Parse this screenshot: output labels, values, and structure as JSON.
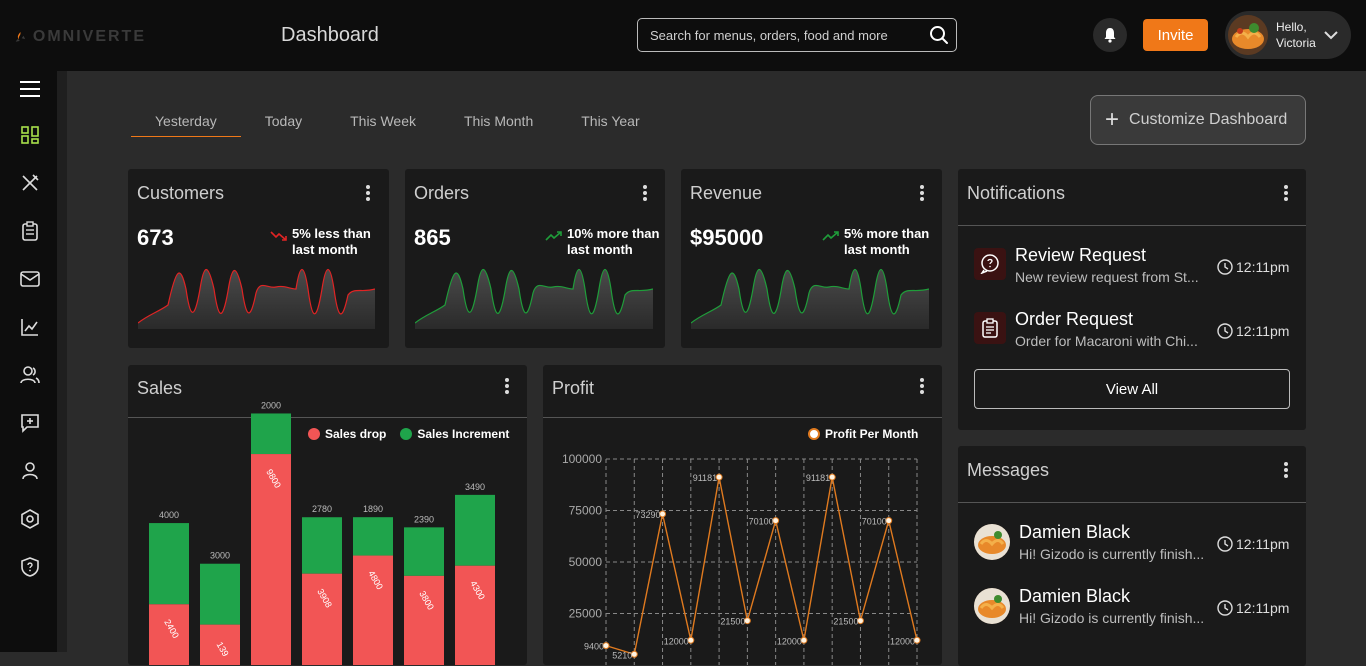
{
  "app": {
    "logo_text": "OMNIVERTE",
    "page_title": "Dashboard"
  },
  "search": {
    "placeholder": "Search for menus, orders, food and more"
  },
  "header": {
    "invite_label": "Invite",
    "greeting_line1": "Hello,",
    "greeting_line2": "Victoria"
  },
  "sidebar": {
    "items": [
      {
        "icon": "menu-icon"
      },
      {
        "icon": "dashboard-grid-icon",
        "active": true
      },
      {
        "icon": "utensils-icon"
      },
      {
        "icon": "clipboard-icon"
      },
      {
        "icon": "mail-icon"
      },
      {
        "icon": "analytics-icon"
      },
      {
        "icon": "users-icon"
      },
      {
        "icon": "message-plus-icon"
      },
      {
        "icon": "user-icon"
      },
      {
        "icon": "settings-hexagon-icon"
      },
      {
        "icon": "shield-question-icon"
      }
    ]
  },
  "tabs": [
    "Yesterday",
    "Today",
    "This Week",
    "This Month",
    "This Year"
  ],
  "customize_label": "Customize Dashboard",
  "stats": [
    {
      "title": "Customers",
      "value": "673",
      "trend_line1": "5% less than",
      "trend_line2": "last month",
      "direction": "down",
      "color": "#e02424"
    },
    {
      "title": "Orders",
      "value": "865",
      "trend_line1": "10% more than",
      "trend_line2": "last month",
      "direction": "up",
      "color": "#1f9d3a"
    },
    {
      "title": "Revenue",
      "value": "$95000",
      "trend_line1": "5% more than",
      "trend_line2": "last month",
      "direction": "up",
      "color": "#1f9d3a"
    }
  ],
  "notifications": {
    "title": "Notifications",
    "items": [
      {
        "title": "Review Request",
        "subtitle": "New review request from St...",
        "time": "12:11pm",
        "icon": "review-chat-icon"
      },
      {
        "title": "Order Request",
        "subtitle": "Order for Macaroni with Chi...",
        "time": "12:11pm",
        "icon": "order-clipboard-icon"
      }
    ],
    "view_all_label": "View All"
  },
  "messages": {
    "title": "Messages",
    "items": [
      {
        "name": "Damien Black",
        "preview": "Hi! Gizodo is currently finish...",
        "time": "12:11pm"
      },
      {
        "name": "Damien Black",
        "preview": "Hi! Gizodo is currently finish...",
        "time": "12:11pm"
      }
    ]
  },
  "sales": {
    "title": "Sales",
    "legend": [
      "Sales drop",
      "Sales Increment"
    ],
    "colors": {
      "drop": "#f25555",
      "increment": "#1fa44b"
    }
  },
  "profit": {
    "title": "Profit",
    "legend": "Profit Per Month",
    "line_color": "#e07a1f"
  },
  "chart_data": [
    {
      "type": "bar",
      "title": "Sales",
      "stacked": true,
      "series": [
        {
          "name": "Sales drop",
          "values": [
            2400,
            1398,
            9800,
            3908,
            4800,
            3800,
            4300
          ]
        },
        {
          "name": "Sales Increment",
          "values": [
            4000,
            3000,
            2000,
            2780,
            1890,
            2390,
            3490
          ]
        }
      ],
      "data_labels_bottom": [
        "2400",
        "139",
        "9800",
        "3908",
        "4800",
        "3800",
        "4300"
      ],
      "data_labels_top": [
        "4000",
        "3000",
        "2000",
        "2780",
        "1890",
        "2390",
        "3490"
      ]
    },
    {
      "type": "line",
      "title": "Profit",
      "series": [
        {
          "name": "Profit Per Month",
          "values": [
            9400,
            5210,
            73290,
            12000,
            91181,
            21500,
            70100,
            12000,
            91181,
            21500,
            70100,
            12000
          ]
        }
      ],
      "point_labels": [
        "9400",
        "5210",
        "73290",
        "12000",
        "91181",
        "21500",
        "70100",
        "12000",
        "91181",
        "21500",
        "70100",
        "12000"
      ],
      "y_ticks": [
        "100000",
        "75000",
        "50000",
        "25000"
      ],
      "ylim": [
        0,
        100000
      ],
      "grid": true
    }
  ]
}
